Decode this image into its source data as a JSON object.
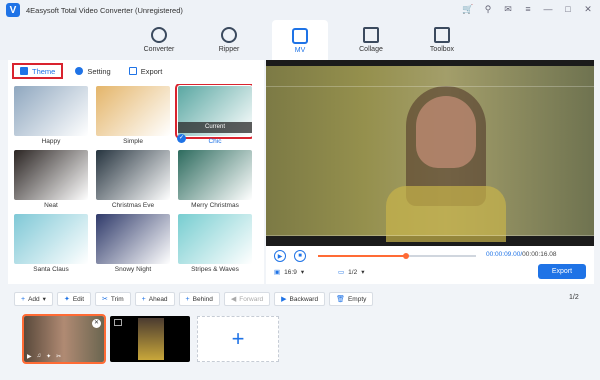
{
  "window": {
    "title": "4Easysoft Total Video Converter (Unregistered)",
    "logo_letter": "V"
  },
  "nav": {
    "tabs": [
      {
        "label": "Converter",
        "icon": "converter-icon"
      },
      {
        "label": "Ripper",
        "icon": "disc-icon"
      },
      {
        "label": "MV",
        "icon": "mv-icon",
        "active": true
      },
      {
        "label": "Collage",
        "icon": "collage-icon"
      },
      {
        "label": "Toolbox",
        "icon": "toolbox-icon"
      }
    ]
  },
  "subtabs": [
    {
      "label": "Theme",
      "active": true
    },
    {
      "label": "Setting"
    },
    {
      "label": "Export"
    }
  ],
  "themes": [
    {
      "label": "Happy",
      "color": "#8fa7bf"
    },
    {
      "label": "Simple",
      "color": "#e4b56a"
    },
    {
      "label": "Chic",
      "color": "#5aa7a2",
      "selected": true,
      "badge": "Current"
    },
    {
      "label": "Neat",
      "color": "#2b2523"
    },
    {
      "label": "Christmas Eve",
      "color": "#26343f"
    },
    {
      "label": "Merry Christmas",
      "color": "#2d6b5e"
    },
    {
      "label": "Santa Claus",
      "color": "#7fc8d6"
    },
    {
      "label": "Snowy Night",
      "color": "#2f3a6a"
    },
    {
      "label": "Stripes & Waves",
      "color": "#77cdd0"
    }
  ],
  "player": {
    "current_time": "00:00:09.00",
    "total_time": "00:00:16.08",
    "progress_fraction": 0.56,
    "aspect": "16:9",
    "layout": "1/2",
    "export_label": "Export"
  },
  "toolbar": {
    "add": "Add",
    "edit": "Edit",
    "trim": "Trim",
    "ahead": "Ahead",
    "behind": "Behind",
    "forward": "Forward",
    "backward": "Backward",
    "empty": "Empty",
    "page": "1",
    "pages": "2"
  },
  "colors": {
    "accent": "#1f73e6",
    "highlight": "#d9232e",
    "progress": "#ff6b35"
  }
}
